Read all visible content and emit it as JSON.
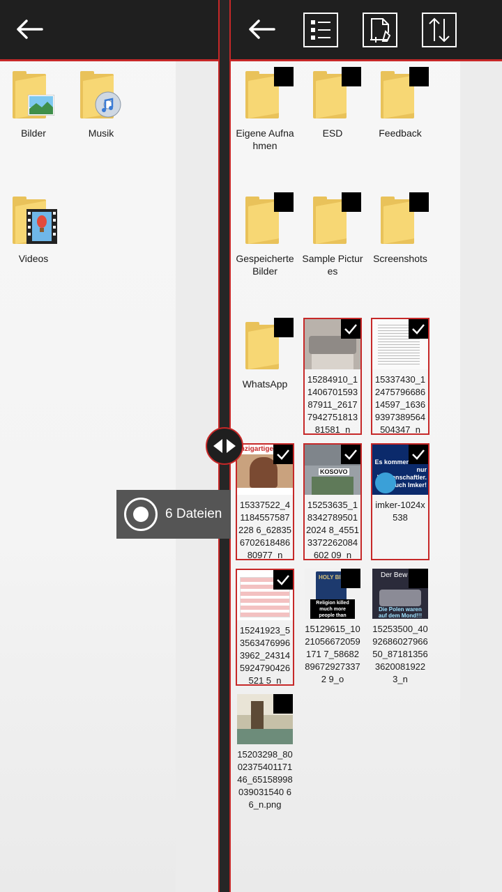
{
  "left_pane": {
    "back_icon": "back-arrow-icon",
    "folders": [
      {
        "label": "Bilder",
        "overlay": "landscape-photo"
      },
      {
        "label": "Musik",
        "overlay": "music-disc"
      },
      {
        "label": "Videos",
        "overlay": "film-strip"
      }
    ]
  },
  "right_pane": {
    "back_icon": "back-arrow-icon",
    "toolbar": [
      "select-list-icon",
      "new-file-icon",
      "sort-icon"
    ],
    "folders": [
      {
        "label": "Eigene Aufnahmen"
      },
      {
        "label": "ESD"
      },
      {
        "label": "Feedback"
      },
      {
        "label": "Gespeicherte Bilder"
      },
      {
        "label": "Sample Pictures"
      },
      {
        "label": "Screenshots"
      },
      {
        "label": "WhatsApp"
      }
    ],
    "files": [
      {
        "label": "15284910_1140670159387911_2617794275181381581_n",
        "selected": true,
        "thumb_text": ""
      },
      {
        "label": "15337430_1247579668614597_16369397389564504347_n",
        "selected": true,
        "thumb_text": ""
      },
      {
        "label": "15337522_41184557587228 6_62835670261848680977_n",
        "selected": true,
        "thumb_text": "inzigartige Aufna"
      },
      {
        "label": "15253635_183427895012024 8_45513372262084602 09_n",
        "selected": true,
        "thumb_text": "KOSOVO"
      },
      {
        "label": "imker-1024x538",
        "selected": true,
        "thumb_text": "Es kommen nicht nur Wissenschaftler. Auch Imker!"
      },
      {
        "label": "15241923_535634769963962_243145924790426521 5_n",
        "selected": true,
        "thumb_text": ""
      },
      {
        "label": "15129615_1021056672059171 7_58682896729273372 9_o",
        "selected": false,
        "thumb_text": "Religion killed much more people than cigarettes"
      },
      {
        "label": "15253500_409268602796650_871813563620081922 3_n",
        "selected": false,
        "thumb_text": "Der Bew Die Polen waren auf dem Mond!!!"
      },
      {
        "label": "15203298_8002375401171 46_65158998039031540 66_n.png",
        "selected": false,
        "thumb_text": ""
      }
    ]
  },
  "split_handle_icon": "split-resize-icon",
  "toast": {
    "icon": "record-icon",
    "text": "6 Dateien"
  },
  "colors": {
    "accent": "#c62828",
    "topbar": "#1f1f1f",
    "folder": "#f7d774"
  }
}
